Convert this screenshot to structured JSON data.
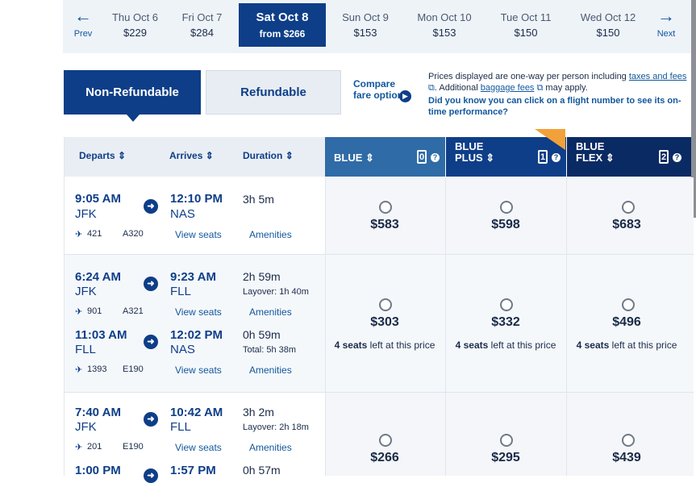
{
  "datebar": {
    "prev_label": "Prev",
    "next_label": "Next",
    "dates": [
      {
        "day": "Thu Oct 6",
        "price": "$229"
      },
      {
        "day": "Fri Oct 7",
        "price": "$284"
      },
      {
        "day": "Sun Oct 9",
        "price": "$153"
      },
      {
        "day": "Mon Oct 10",
        "price": "$153"
      },
      {
        "day": "Tue Oct 11",
        "price": "$150"
      },
      {
        "day": "Wed Oct 12",
        "price": "$150"
      }
    ],
    "selected": {
      "day": "Sat Oct 8",
      "price": "from $266"
    }
  },
  "fare_tabs": {
    "non_refundable": "Non-Refundable",
    "refundable": "Refundable"
  },
  "compare": {
    "label": "Compare fare options"
  },
  "info": {
    "text1": "Prices displayed are one-way per person including",
    "taxes_link": "taxes and fees",
    "text2": "Additional",
    "baggage_link": "baggage fees",
    "text3": "may apply.",
    "question": "Did you know you can click on a flight number to see its on-time performance?"
  },
  "columns": {
    "departs": "Departs",
    "arrives": "Arrives",
    "duration": "Duration"
  },
  "fares": [
    {
      "name_line1": "BLUE",
      "name_line2": "",
      "bags": "0",
      "color": "#2f6ba6"
    },
    {
      "name_line1": "BLUE",
      "name_line2": "PLUS",
      "bags": "1",
      "color": "#0e3e88"
    },
    {
      "name_line1": "BLUE",
      "name_line2": "FLEX",
      "bags": "2",
      "color": "#0a2a63"
    }
  ],
  "links": {
    "view_seats": "View seats",
    "amenities": "Amenities"
  },
  "flights": [
    {
      "legs": [
        {
          "dep_time": "9:05 AM",
          "dep_airport": "JFK",
          "arr_time": "12:10 PM",
          "arr_airport": "NAS",
          "duration": "3h 5m",
          "note": "",
          "flight_no": "421",
          "aircraft": "A320"
        }
      ],
      "prices": [
        "$583",
        "$598",
        "$683"
      ],
      "seats_left": [
        "",
        "",
        ""
      ]
    },
    {
      "legs": [
        {
          "dep_time": "6:24 AM",
          "dep_airport": "JFK",
          "arr_time": "9:23 AM",
          "arr_airport": "FLL",
          "duration": "2h 59m",
          "note": "Layover: 1h 40m",
          "flight_no": "901",
          "aircraft": "A321"
        },
        {
          "dep_time": "11:03 AM",
          "dep_airport": "FLL",
          "arr_time": "12:02 PM",
          "arr_airport": "NAS",
          "duration": "0h 59m",
          "note": "Total: 5h 38m",
          "flight_no": "1393",
          "aircraft": "E190"
        }
      ],
      "prices": [
        "$303",
        "$332",
        "$496"
      ],
      "seats_left": [
        "4 seats",
        "4 seats",
        "4 seats"
      ],
      "seats_suffix": "left at this price"
    },
    {
      "legs": [
        {
          "dep_time": "7:40 AM",
          "dep_airport": "JFK",
          "arr_time": "10:42 AM",
          "arr_airport": "FLL",
          "duration": "3h 2m",
          "note": "Layover: 2h 18m",
          "flight_no": "201",
          "aircraft": "E190"
        },
        {
          "dep_time": "1:00 PM",
          "dep_airport": "",
          "arr_time": "1:57 PM",
          "arr_airport": "",
          "duration": "0h 57m",
          "note": "",
          "flight_no": "",
          "aircraft": ""
        }
      ],
      "prices": [
        "$266",
        "$295",
        "$439"
      ],
      "seats_left": [
        "",
        "",
        ""
      ]
    }
  ]
}
